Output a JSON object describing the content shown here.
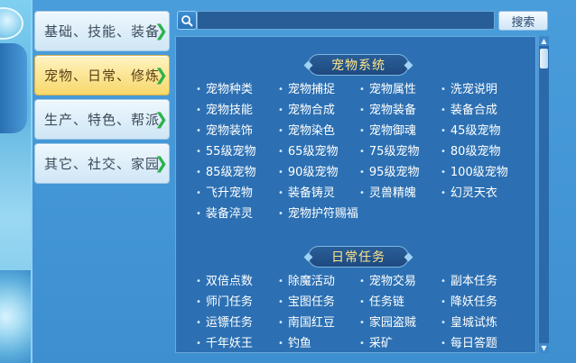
{
  "sidebar": {
    "items": [
      {
        "label": "基础、技能、装备"
      },
      {
        "label": "宠物、日常、修炼"
      },
      {
        "label": "生产、特色、帮派"
      },
      {
        "label": "其它、社交、家园"
      }
    ],
    "active_index": 1
  },
  "search": {
    "value": "",
    "button_label": "搜索"
  },
  "sections": [
    {
      "title": "宠物系统",
      "items": [
        "宠物种类",
        "宠物捕捉",
        "宠物属性",
        "洗宠说明",
        "宠物技能",
        "宠物合成",
        "宠物装备",
        "装备合成",
        "宠物装饰",
        "宠物染色",
        "宠物御魂",
        "45级宠物",
        "55级宠物",
        "65级宠物",
        "75级宠物",
        "80级宠物",
        "85级宠物",
        "90级宠物",
        "95级宠物",
        "100级宠物",
        "飞升宠物",
        "装备铸灵",
        "灵兽精魄",
        "幻灵天衣",
        "装备淬灵",
        "宠物护符赐福"
      ]
    },
    {
      "title": "日常任务",
      "items": [
        "双倍点数",
        "除魔活动",
        "宠物交易",
        "副本任务",
        "师门任务",
        "宝图任务",
        "任务链",
        "降妖任务",
        "运镖任务",
        "南国红豆",
        "家园盗贼",
        "皇城试炼",
        "千年妖王",
        "钓鱼",
        "采矿",
        "每日答题"
      ]
    }
  ],
  "colors": {
    "panel_bg": "#2c70b3",
    "section_title": "#ffe58a",
    "active_tab": "#f7d86a",
    "chevron": "#2bb24c"
  }
}
